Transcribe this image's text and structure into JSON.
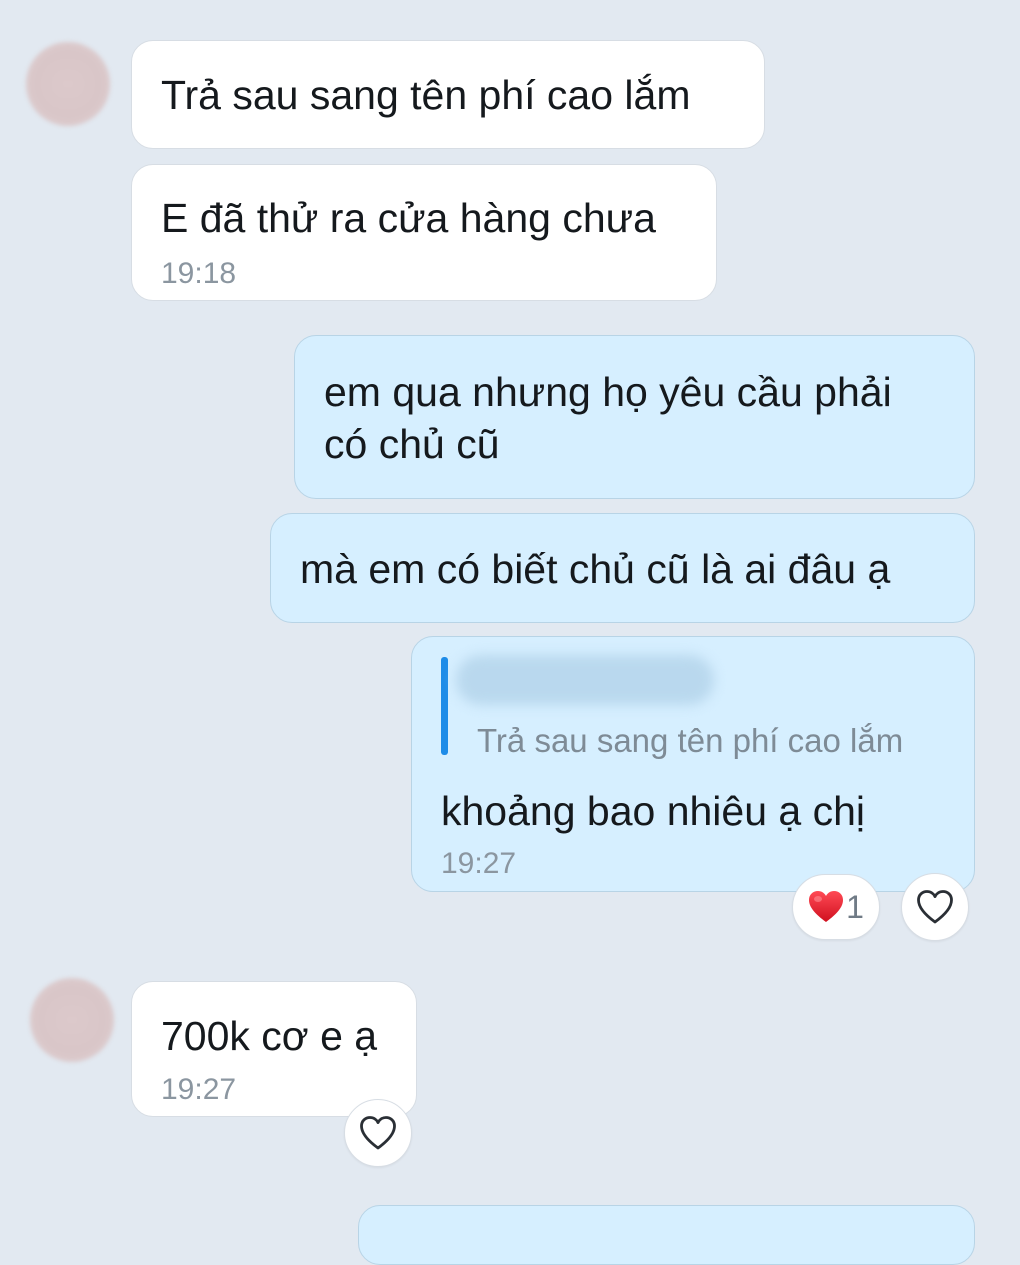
{
  "messages": [
    {
      "side": "incoming",
      "text": "Trả sau sang tên phí cao lắm"
    },
    {
      "side": "incoming",
      "text": "E đã thử ra cửa hàng chưa",
      "time": "19:18"
    },
    {
      "side": "outgoing",
      "lines": [
        "em qua nhưng họ yêu cầu phải",
        "có chủ cũ"
      ]
    },
    {
      "side": "outgoing",
      "text": "mà em có biết chủ cũ là ai đâu ạ"
    },
    {
      "side": "outgoing",
      "quote": {
        "text": "Trả sau sang tên phí cao lắm"
      },
      "text": "khoảng bao nhiêu ạ chị",
      "time": "19:27",
      "reaction": {
        "icon": "heart-red-icon",
        "count": "1"
      }
    },
    {
      "side": "incoming",
      "text": "700k cơ e ạ",
      "time": "19:27"
    }
  ],
  "colors": {
    "background": "#e2e9f1",
    "incoming_bubble": "#ffffff",
    "outgoing_bubble": "#d6efff",
    "quote_bar": "#1e8ce8",
    "heart": "#e8202f"
  }
}
